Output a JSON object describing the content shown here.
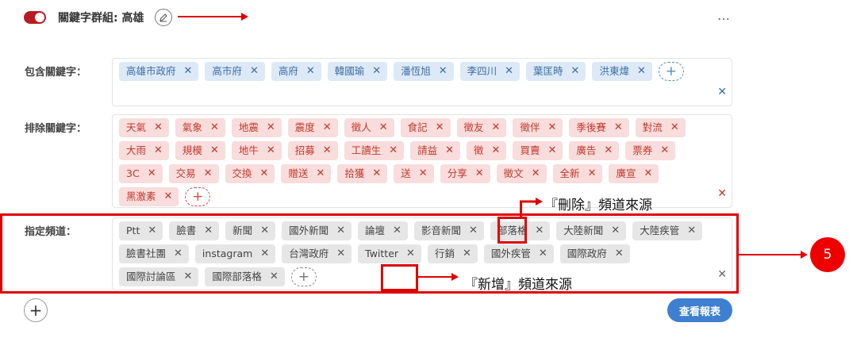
{
  "group": {
    "toggle_on": true,
    "title": "關鍵字群組: 高雄",
    "edit_icon": "pencil-icon",
    "more_icon": "…"
  },
  "include": {
    "label": "包含關鍵字：",
    "tags": [
      "高雄市政府",
      "高市府",
      "高府",
      "韓國瑜",
      "潘恆旭",
      "李四川",
      "葉匡時",
      "洪東煒"
    ],
    "add_label": "+",
    "clear_label": "✕"
  },
  "exclude": {
    "label": "排除關鍵字：",
    "tags": [
      "天氣",
      "氣象",
      "地震",
      "震度",
      "徵人",
      "食記",
      "徵友",
      "徵伴",
      "季後賽",
      "對流",
      "大雨",
      "規模",
      "地牛",
      "招募",
      "工讀生",
      "請益",
      "徵",
      "買賣",
      "廣告",
      "票券",
      "3C",
      "交易",
      "交換",
      "贈送",
      "拾獲",
      "送",
      "分享",
      "徵文",
      "全新",
      "廣宣",
      "黑激素"
    ],
    "add_label": "+",
    "clear_label": "✕"
  },
  "channels": {
    "label": "指定頻道：",
    "tags": [
      "Ptt",
      "臉書",
      "新聞",
      "國外新聞",
      "論壇",
      "影音新聞",
      "部落格",
      "大陸新聞",
      "大陸疾管",
      "臉書社團",
      "instagram",
      "台灣政府",
      "Twitter",
      "行銷",
      "國外疾管",
      "國際政府",
      "國際討論區",
      "國際部落格"
    ],
    "add_label": "+",
    "clear_label": "✕"
  },
  "annotations": {
    "delete_note": "『刪除』頻道來源",
    "add_note": "『新增』頻道來源",
    "step_number": "5"
  },
  "footer": {
    "add_group_label": "+",
    "report_button": "查看報表"
  },
  "colors": {
    "toggle": "#b81c22",
    "include_tag_bg": "#dde9f7",
    "include_tag_text": "#3b6ea5",
    "exclude_tag_bg": "#f9dcdc",
    "exclude_tag_text": "#c0392b",
    "channel_tag_bg": "#e6e6e6",
    "annotation_red": "#e00000",
    "report_button": "#3f7fd1"
  }
}
